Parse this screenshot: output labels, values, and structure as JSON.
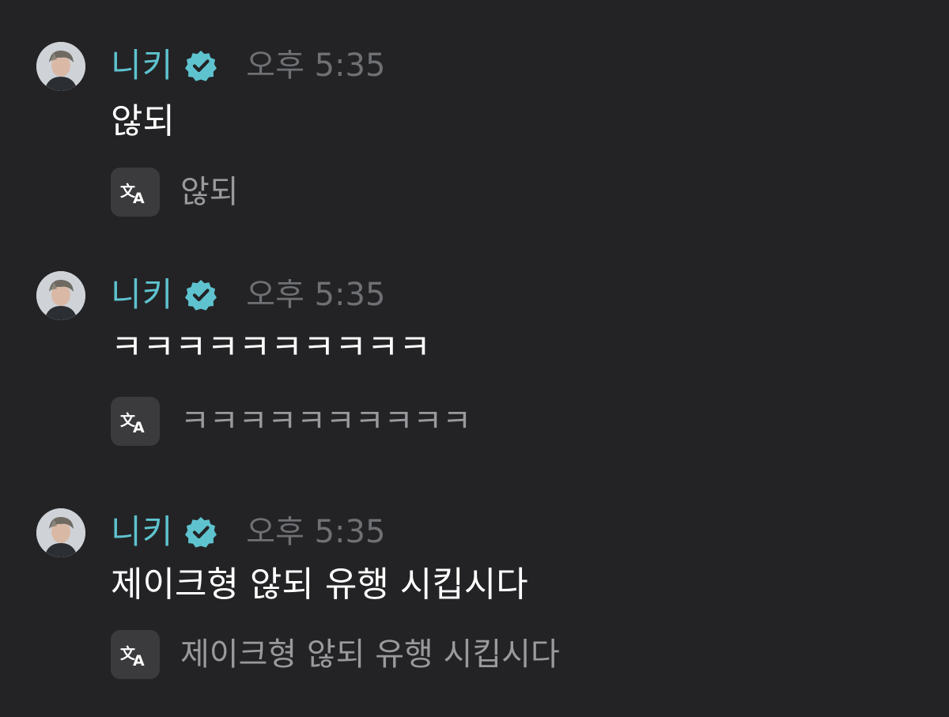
{
  "colors": {
    "background": "#232325",
    "username": "#5ec3cf",
    "verified_badge": "#5ec3cf",
    "timestamp": "#6f7074",
    "message_text": "#ffffff",
    "translated_text": "#9a9a9e",
    "translate_button": "#3b3b3e"
  },
  "messages": [
    {
      "username": "니키",
      "timestamp": "오후 5:35",
      "text": "않되",
      "translation": "않되",
      "avatar_icon": "user-avatar",
      "badge_icon": "verified-badge-icon",
      "translate_icon": "translate-icon"
    },
    {
      "username": "니키",
      "timestamp": "오후 5:35",
      "text": "ㅋㅋㅋㅋㅋㅋㅋㅋㅋㅋ",
      "translation": "ㅋㅋㅋㅋㅋㅋㅋㅋㅋㅋ",
      "avatar_icon": "user-avatar",
      "badge_icon": "verified-badge-icon",
      "translate_icon": "translate-icon"
    },
    {
      "username": "니키",
      "timestamp": "오후 5:35",
      "text": "제이크형 않되 유행 시킵시다",
      "translation": "제이크형 않되 유행 시킵시다",
      "avatar_icon": "user-avatar",
      "badge_icon": "verified-badge-icon",
      "translate_icon": "translate-icon"
    }
  ]
}
